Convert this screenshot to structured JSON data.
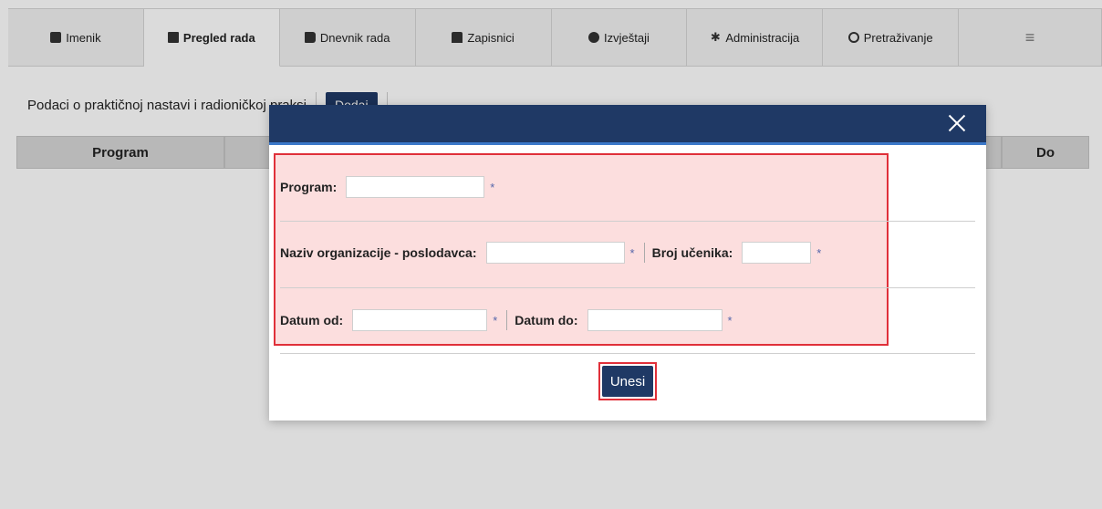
{
  "nav": {
    "tabs": [
      {
        "label": "Imenik",
        "icon": "address-book-icon"
      },
      {
        "label": "Pregled rada",
        "icon": "clipboard-icon",
        "active": true
      },
      {
        "label": "Dnevnik rada",
        "icon": "book-icon"
      },
      {
        "label": "Zapisnici",
        "icon": "archive-icon"
      },
      {
        "label": "Izvještaji",
        "icon": "pie-chart-icon"
      },
      {
        "label": "Administracija",
        "icon": "gear-icon"
      },
      {
        "label": "Pretraživanje",
        "icon": "search-icon"
      }
    ],
    "menu_icon": "hamburger-menu-icon"
  },
  "page": {
    "section_title": "Podaci o praktičnoj nastavi i radioničkoj praksi",
    "add_button": "Dodaj",
    "table_headers": {
      "program": "Program",
      "do": "Do"
    }
  },
  "modal": {
    "close_icon": "close-icon",
    "fields": {
      "program_label": "Program:",
      "organization_label": "Naziv organizacije - poslodavca:",
      "students_label": "Broj učenika:",
      "date_from_label": "Datum od:",
      "date_to_label": "Datum do:",
      "required_mark": "*"
    },
    "submit_button": "Unesi"
  },
  "colors": {
    "primary": "#1f3965",
    "highlight_border": "#e0303a",
    "highlight_fill": "#fcdede"
  }
}
